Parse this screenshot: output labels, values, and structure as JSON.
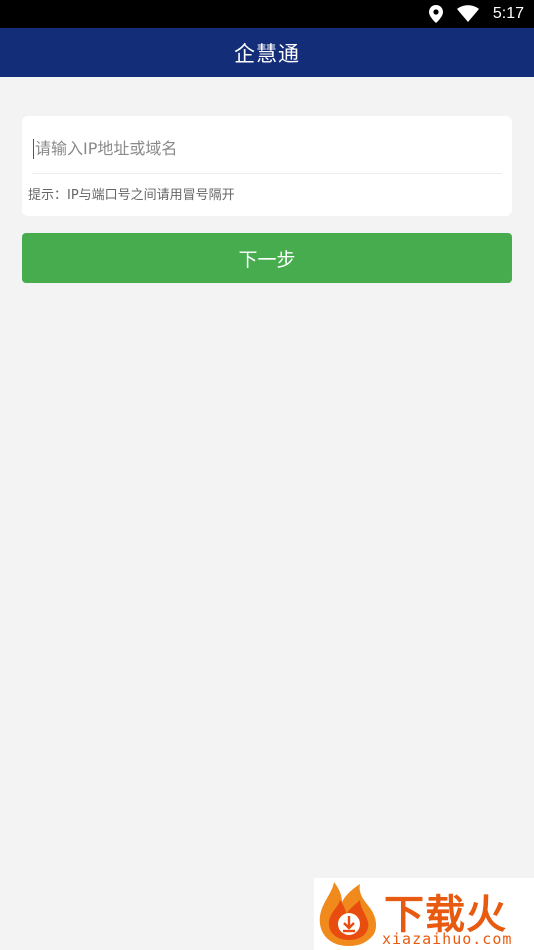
{
  "status_bar": {
    "time": "5:17",
    "icons": [
      "location-icon",
      "wifi-icon"
    ]
  },
  "app_bar": {
    "title": "企慧通"
  },
  "form": {
    "ip_input": {
      "value": "",
      "placeholder": "请输入IP地址或域名"
    },
    "hint": "提示：IP与端口号之间请用冒号隔开",
    "next_button_label": "下一步"
  },
  "watermark": {
    "title": "下载火",
    "domain": "xiazaihuo.com"
  },
  "colors": {
    "app_bar": "#132d79",
    "button": "#46ac4e",
    "background": "#f3f3f3",
    "watermark": "#e85a10"
  }
}
